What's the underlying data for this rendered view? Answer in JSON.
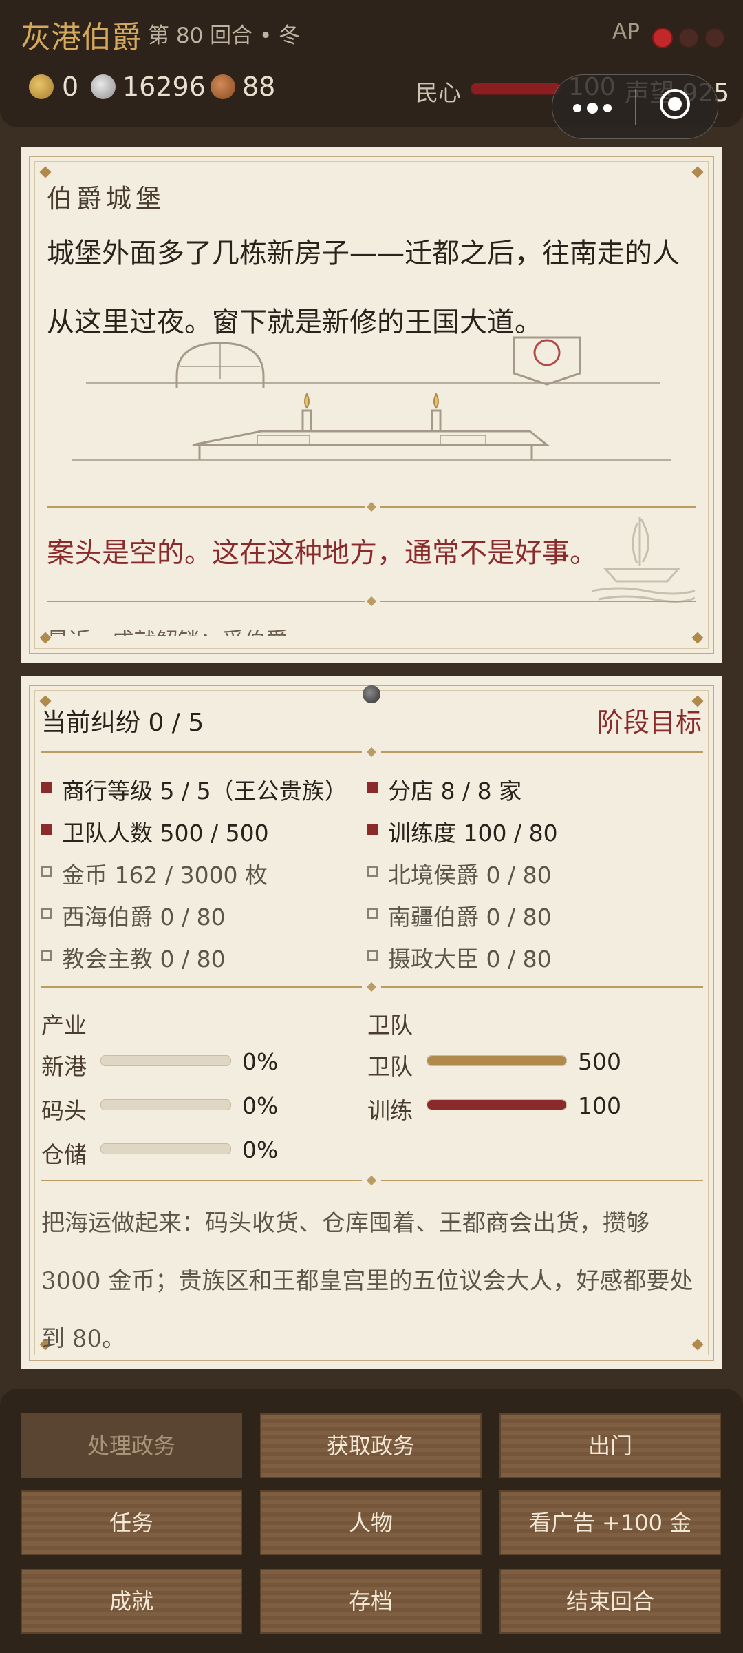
{
  "header": {
    "title": "灰港伯爵",
    "turn": "第 80 回合 • 冬",
    "ap_label": "AP",
    "ap_total": 3,
    "ap_filled": 1,
    "resources": {
      "gold": "0",
      "silver": "16296",
      "copper": "88"
    },
    "minxin_label": "民心",
    "minxin_value": "100",
    "fame_text": "声望 925"
  },
  "story": {
    "location": "伯爵城堡",
    "text": "城堡外面多了几栋新房子——迁都之后，往南走的人从这里过夜。窗下就是新修的王国大道。",
    "alert": "案头是空的。这在这种地方，通常不是好事。",
    "recent": "最近 · 成就解锁：受伯爵"
  },
  "disputes": {
    "title": "当前纠纷  0 / 5",
    "link": "阶段目标",
    "goals": [
      {
        "label": "商行等级  5 / 5（王公贵族）",
        "done": true
      },
      {
        "label": "分店  8 / 8 家",
        "done": true
      },
      {
        "label": "卫队人数  500 / 500",
        "done": true
      },
      {
        "label": "训练度  100 / 80",
        "done": true
      },
      {
        "label": "金币  162 / 3000 枚",
        "done": false
      },
      {
        "label": "北境侯爵  0 / 80",
        "done": false
      },
      {
        "label": "西海伯爵  0 / 80",
        "done": false
      },
      {
        "label": "南疆伯爵  0 / 80",
        "done": false
      },
      {
        "label": "教会主教  0 / 80",
        "done": false
      },
      {
        "label": "摄政大臣  0 / 80",
        "done": false
      }
    ],
    "industry": {
      "title": "产业",
      "items": [
        {
          "label": "新港",
          "value": "0%",
          "level": 0
        },
        {
          "label": "码头",
          "value": "0%",
          "level": 0
        },
        {
          "label": "仓储",
          "value": "0%",
          "level": 0
        }
      ]
    },
    "guard": {
      "title": "卫队",
      "items": [
        {
          "label": "卫队",
          "value": "500",
          "level": 1.0,
          "color": "#b08a4c"
        },
        {
          "label": "训练",
          "value": "100",
          "level": 1.0,
          "color": "#8b2a2a"
        }
      ]
    },
    "description": "把海运做起来：码头收货、仓库囤着、王都商会出货，攒够 3000 金币；贵族区和王都皇宫里的五位议会大人，好感都要处到 80。"
  },
  "buttons": {
    "handle_affairs": "处理政务",
    "get_affairs": "获取政务",
    "go_out": "出门",
    "tasks": "任务",
    "characters": "人物",
    "watch_ad": "看广告 +100 金",
    "achievements": "成就",
    "save": "存档",
    "end_turn": "结束回合"
  },
  "colors": {
    "accent_gold": "#d4a95c",
    "accent_red": "#8b2a2a",
    "panel": "#f3ede0"
  }
}
